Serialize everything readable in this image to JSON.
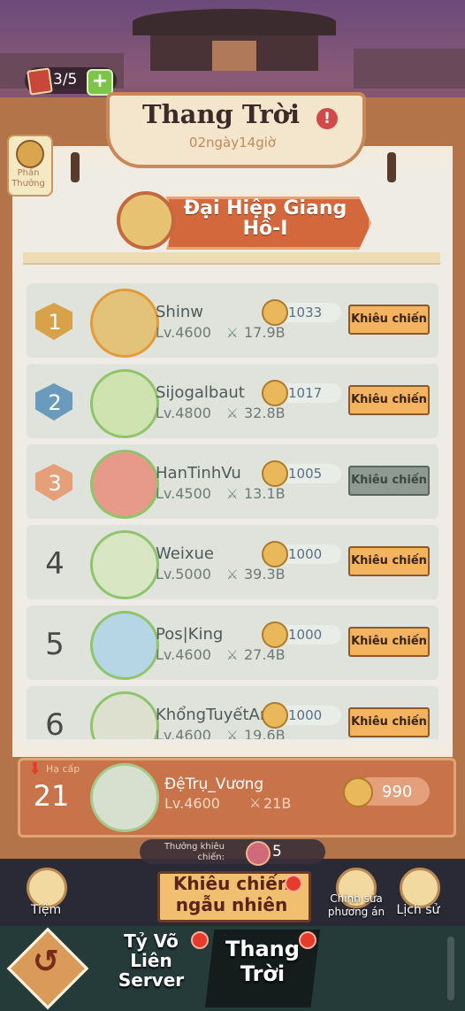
{
  "header": {
    "tickets": "3/5",
    "add_label": "+",
    "title": "Thang Trời",
    "timer": "02ngày14giờ",
    "reward_label": "Phần Thưởng"
  },
  "tier": {
    "name": "Đại Hiệp Giang Hồ-I"
  },
  "ranking": [
    {
      "rank": "1",
      "name": "Shinw",
      "level": "Lv.4600",
      "power": "17.9B",
      "score": "1033",
      "action": "Khiêu chiến",
      "enabled": true,
      "badge_color": "#d8a24a"
    },
    {
      "rank": "2",
      "name": "Sijogalbaut",
      "level": "Lv.4800",
      "power": "32.8B",
      "score": "1017",
      "action": "Khiêu chiến",
      "enabled": true,
      "badge_color": "#6a9abc"
    },
    {
      "rank": "3",
      "name": "HanTinhVu",
      "level": "Lv.4500",
      "power": "13.1B",
      "score": "1005",
      "action": "Khiêu chiến",
      "enabled": false,
      "badge_color": "#e5a07a"
    },
    {
      "rank": "4",
      "name": "Weixue",
      "level": "Lv.5000",
      "power": "39.3B",
      "score": "1000",
      "action": "Khiêu chiến",
      "enabled": true
    },
    {
      "rank": "5",
      "name": "Pos|King",
      "level": "Lv.4600",
      "power": "27.4B",
      "score": "1000",
      "action": "Khiêu chiến",
      "enabled": true
    },
    {
      "rank": "6",
      "name": "KhổngTuyếtAn",
      "level": "Lv.4600",
      "power": "19.6B",
      "score": "1000",
      "action": "Khiêu chiến",
      "enabled": true
    }
  ],
  "me": {
    "status": "Hạ cấp",
    "rank": "21",
    "name": "ĐệTrụ_Vương",
    "level": "Lv.4600",
    "power": "21B",
    "score": "990"
  },
  "challenge_reward": {
    "label": "Thưởng khiêu chiến:",
    "value": "5"
  },
  "actions": {
    "shop": "Tiệm",
    "random": "Khiêu chiến ngẫu nhiên",
    "edit_plan": "Chỉnh sửa phương án",
    "history": "Lịch sử"
  },
  "nav": {
    "tab1": "Tỷ Võ Liên Server",
    "tab2": "Thang Trời"
  },
  "colors": {
    "board": "#b4744a",
    "challenge": "#f3b35f",
    "challenge_disabled": "#8f9a92",
    "my_row": "#c8734a"
  }
}
